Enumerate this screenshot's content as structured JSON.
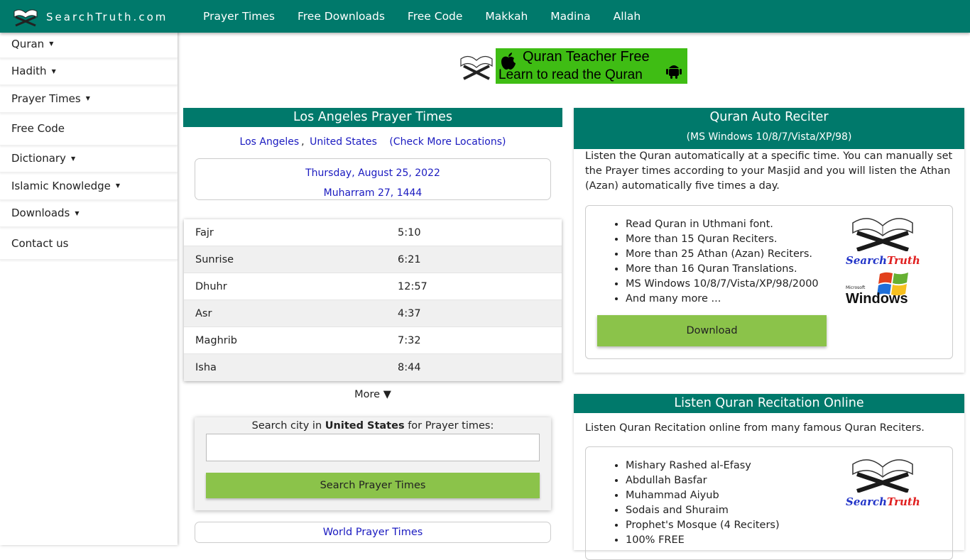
{
  "brand": {
    "name": "SearchTruth.com"
  },
  "topnav": [
    "Prayer Times",
    "Free Downloads",
    "Free Code",
    "Makkah",
    "Madina",
    "Allah"
  ],
  "sidebar": {
    "items": [
      {
        "label": "Quran",
        "has_caret": true
      },
      {
        "label": "Hadith",
        "has_caret": true
      },
      {
        "label": "Prayer Times",
        "has_caret": true
      },
      {
        "label": "Free Code",
        "has_caret": false
      },
      {
        "label": "Dictionary",
        "has_caret": true
      },
      {
        "label": "Islamic Knowledge",
        "has_caret": true
      },
      {
        "label": "Downloads",
        "has_caret": true
      },
      {
        "label": "Contact us",
        "has_caret": false
      }
    ]
  },
  "banner": {
    "line1": "Quran Teacher Free",
    "line2": "Learn to read the Quran"
  },
  "prayer": {
    "title": "Los Angeles Prayer Times",
    "city": "Los Angeles",
    "sep": ",",
    "country": "United States",
    "more_locations": "(Check More Locations)",
    "gregorian": "Thursday, August 25, 2022",
    "hijri": "Muharram 27, 1444",
    "times": [
      {
        "name": "Fajr",
        "time": "5:10"
      },
      {
        "name": "Sunrise",
        "time": "6:21"
      },
      {
        "name": "Dhuhr",
        "time": "12:57"
      },
      {
        "name": "Asr",
        "time": "4:37"
      },
      {
        "name": "Maghrib",
        "time": "7:32"
      },
      {
        "name": "Isha",
        "time": "8:44"
      }
    ],
    "more": "More ▼",
    "search_pre": "Search city in ",
    "search_country": "United States",
    "search_post": " for Prayer times:",
    "search_value": "",
    "search_button": "Search Prayer Times",
    "world": "World Prayer Times"
  },
  "reciter": {
    "title": "Quran Auto Reciter",
    "subtitle": "(MS Windows 10/8/7/Vista/XP/98)",
    "description": "Listen the Quran automatically at a specific time. You can manually set the Prayer times according to your Masjid and you will listen the Athan (Azan) automatically five times a day.",
    "features": [
      "Read Quran in Uthmani font.",
      "More than 15 Quran Reciters.",
      "More than 25 Athan (Azan) Reciters.",
      "More than 16 Quran Translations.",
      "MS Windows 10/8/7/Vista/XP/98/2000",
      "And many more ..."
    ],
    "download": "Download",
    "logo_text_1": "Search",
    "logo_text_2": "Truth",
    "windows_small": "Microsoft",
    "windows_word": "Windows"
  },
  "recitation": {
    "title": "Listen Quran Recitation Online",
    "description": "Listen Quran Recitation online from many famous Quran Reciters.",
    "reciters": [
      "Mishary Rashed al-Efasy",
      "Abdullah Basfar",
      "Muhammad Aiyub",
      "Sodais and Shuraim",
      "Prophet's Mosque (4 Reciters)",
      "100% FREE"
    ]
  },
  "colors": {
    "teal": "#00796b",
    "green_button": "#8bc34a",
    "banner_green": "#3fbd14",
    "link_blue": "#1a1ac0"
  }
}
